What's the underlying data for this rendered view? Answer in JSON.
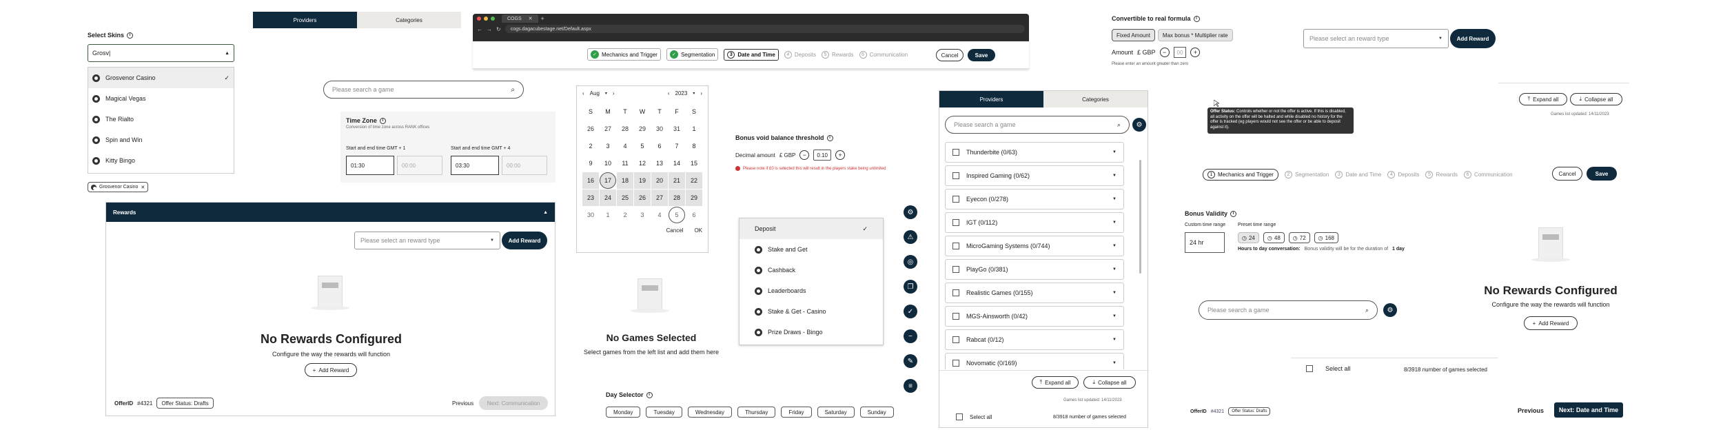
{
  "select_skins": {
    "title": "Select Skins",
    "input_value": "Grosv|",
    "options": [
      "Grosvenor Casino",
      "Magical Vegas",
      "The Rialto",
      "Spin and Win",
      "Kitty Bingo"
    ],
    "selected_chip": "Grosvenor Casino"
  },
  "tabs_top": {
    "providers": "Providers",
    "categories": "Categories"
  },
  "browser": {
    "tab": "COGS",
    "url": "cogs.dagacubestage.net/Default.aspx"
  },
  "wizard_steps": [
    "Mechanics and Trigger",
    "Segmentation",
    "Date and Time",
    "Deposits",
    "Rewards",
    "Communication"
  ],
  "wizard_steps_right": [
    "Mechanics and Trigger",
    "Segmentation",
    "Date and Time",
    "Deposits",
    "Rewards",
    "Communication"
  ],
  "wizard_nums": [
    "1",
    "2",
    "3",
    "4",
    "5",
    "6"
  ],
  "actions": {
    "cancel": "Cancel",
    "save": "Save"
  },
  "search_game": {
    "placeholder": "Please search a game"
  },
  "timezone": {
    "title": "Time Zone",
    "subtitle": "Conversion of time zone across RANK offices",
    "label1": "Start and end time GMT + 1",
    "label2": "Start and end time GMT + 4",
    "v1": "01:30",
    "v1b": "00:00",
    "v2": "03:30",
    "v2b": "00:00"
  },
  "calendar": {
    "month": "Aug",
    "year": "2023",
    "days": [
      "S",
      "M",
      "T",
      "W",
      "T",
      "F",
      "S"
    ],
    "rows": [
      [
        "26",
        "27",
        "28",
        "29",
        "30",
        "31",
        "1"
      ],
      [
        "2",
        "3",
        "4",
        "5",
        "6",
        "7",
        "8"
      ],
      [
        "9",
        "10",
        "11",
        "12",
        "13",
        "14",
        "15"
      ],
      [
        "16",
        "17",
        "18",
        "19",
        "20",
        "21",
        "22"
      ],
      [
        "23",
        "24",
        "25",
        "26",
        "27",
        "28",
        "29"
      ],
      [
        "30",
        "1",
        "2",
        "3",
        "4",
        "5",
        "6"
      ]
    ],
    "cancel": "Cancel",
    "ok": "OK"
  },
  "bonus_void": {
    "title": "Bonus void balance threshold",
    "decimal_label": "Decimal amount",
    "currency": "£ GBP",
    "value": "0.10",
    "error": "Please note if £0 is selected this will result in the players stake being unlimited"
  },
  "deposit_menu": {
    "items": [
      "Deposit",
      "Stake and Get",
      "Cashback",
      "Leaderboards",
      "Stake & Get - Casino",
      "Prize Draws - Bingo"
    ]
  },
  "no_games": {
    "title": "No Games Selected",
    "subtitle": "Select games from the left list and add them here"
  },
  "day_selector": {
    "title": "Day Selector",
    "days": [
      "Monday",
      "Tuesday",
      "Wednesday",
      "Thursday",
      "Friday",
      "Saturday",
      "Sunday"
    ]
  },
  "rewards_panel": {
    "title": "Rewards",
    "placeholder": "Please select an reward type",
    "add_reward": "Add Reward",
    "empty_title": "No Rewards Configured",
    "empty_sub": "Configure the way the rewards will function",
    "add_btn": "Add Reward",
    "offer_label": "OfferID",
    "offer_id": "#4321",
    "status": "Offer Status: Drafts",
    "previous": "Previous",
    "next": "Next: Communication"
  },
  "providers": {
    "tab1": "Providers",
    "tab2": "Categories",
    "placeholder": "Please search a game",
    "rows": [
      "Thunderbite (0/63)",
      "Inspired Gaming (0/62)",
      "Eyecon (0/278)",
      "IGT (0/112)",
      "MicroGaming Systems (0/744)",
      "PlayGo (0/381)",
      "Realistic Games (0/155)",
      "MGS-Ainsworth (0/42)",
      "Rabcat (0/12)",
      "Novomatic (0/169)"
    ],
    "expand": "Expand all",
    "collapse": "Collapse all",
    "updated": "Games list updated: 14/11/2023",
    "select_all": "Select all",
    "count": "8/3918 number of games selected"
  },
  "convertible": {
    "title": "Convertible to real formula",
    "opt1": "Fixed Amount",
    "opt2": "Max bonus * Multiplier rate",
    "amount_label": "Amount",
    "currency": "£ GBP",
    "value": "00",
    "hint": "Please enter an amount greater than zero"
  },
  "tooltip": {
    "title": "Offer Status:",
    "text": "Controls whether or not the offer is active. If this is disabled, all activity on the offer will be halted and while disabled no history for the offer is tracked (eg players would not see the offer or be able to deposit against it)."
  },
  "reward_select_top": {
    "placeholder": "Please select an reward type",
    "add": "Add Reward"
  },
  "expand_collapse": {
    "expand": "Expand all",
    "collapse": "Collapse all",
    "updated": "Games list updated: 14/11/2023"
  },
  "bonus_validity": {
    "title": "Bonus Validity",
    "custom": "Custom time range",
    "preset": "Preset time range",
    "value": "24 hr",
    "presets": [
      "24",
      "48",
      "72",
      "168"
    ],
    "hours_label": "Hours to day conversation:",
    "hours_text": "Bonus validity will be for the duration of",
    "hours_val": "1 day"
  },
  "no_rewards_right": {
    "title": "No Rewards Configured",
    "sub": "Configure the way the rewards will function",
    "add": "Add Reward"
  },
  "select_all_right": {
    "label": "Select all",
    "count": "8/3918 number of games selected"
  },
  "footer_right": {
    "offer_label": "OfferID",
    "offer_id": "#4321",
    "status": "Offer Status: Drafts",
    "previous": "Previous",
    "next": "Next: Date and Time"
  }
}
